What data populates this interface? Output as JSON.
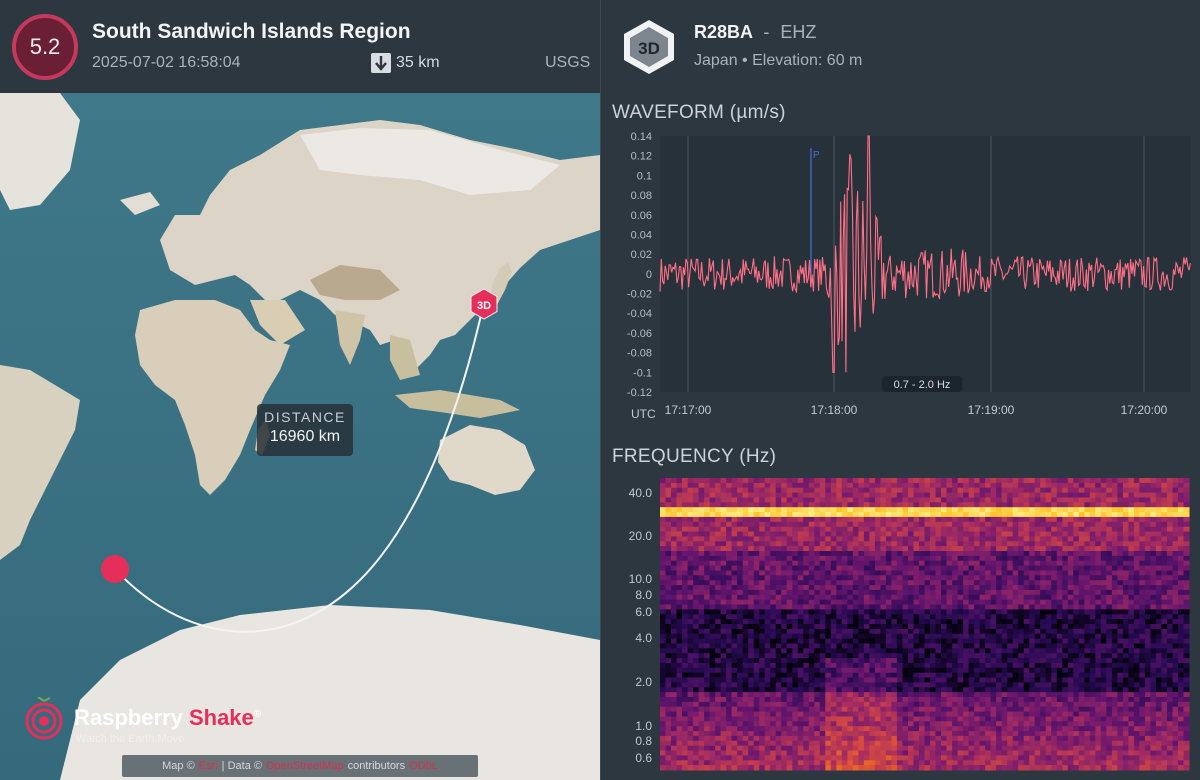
{
  "event": {
    "magnitude": "5.2",
    "region": "South Sandwich Islands Region",
    "datetime": "2025-07-02 16:58:04",
    "depth": "35 km",
    "source": "USGS"
  },
  "map": {
    "station_marker": "3D",
    "distance_label": "DISTANCE",
    "distance_value": "16960 km",
    "brand_name_part1": "Raspberry ",
    "brand_name_part2": "Shake",
    "brand_mark": "®",
    "brand_tagline": "Watch the Earth Move",
    "attribution_prefix": "Map ©",
    "attribution_map_link": "Esri",
    "attribution_data": "| Data ©",
    "attribution_data_link": "OpenStreetMap",
    "attribution_contributors": "contributors",
    "attribution_license": "ODbL"
  },
  "station": {
    "badge": "3D",
    "code": "R28BA",
    "separator": "-",
    "channel": "EHZ",
    "location": "Japan • Elevation: 60 m"
  },
  "waveform": {
    "title": "WAVEFORM (µm/s)",
    "tz_label": "UTC",
    "filter_label": "0.7 - 2.0 Hz",
    "phase_label": "P",
    "y_ticks": [
      "0.14",
      "0.12",
      "0.1",
      "0.08",
      "0.06",
      "0.04",
      "0.02",
      "0",
      "-0.02",
      "-0.04",
      "-0.06",
      "-0.08",
      "-0.1",
      "-0.12"
    ],
    "x_ticks": [
      "17:17:00",
      "17:18:00",
      "17:19:00",
      "17:20:00"
    ]
  },
  "spectrogram": {
    "title": "FREQUENCY (Hz)",
    "y_ticks": [
      "40.0",
      "20.0",
      "10.0",
      "8.0",
      "6.0",
      "4.0",
      "2.0",
      "1.0",
      "0.8",
      "0.6"
    ]
  },
  "colors": {
    "accent": "#e52f5a",
    "waveform": "#ff6f86",
    "pwave": "#4b6bd6",
    "background": "#2d3740"
  }
}
